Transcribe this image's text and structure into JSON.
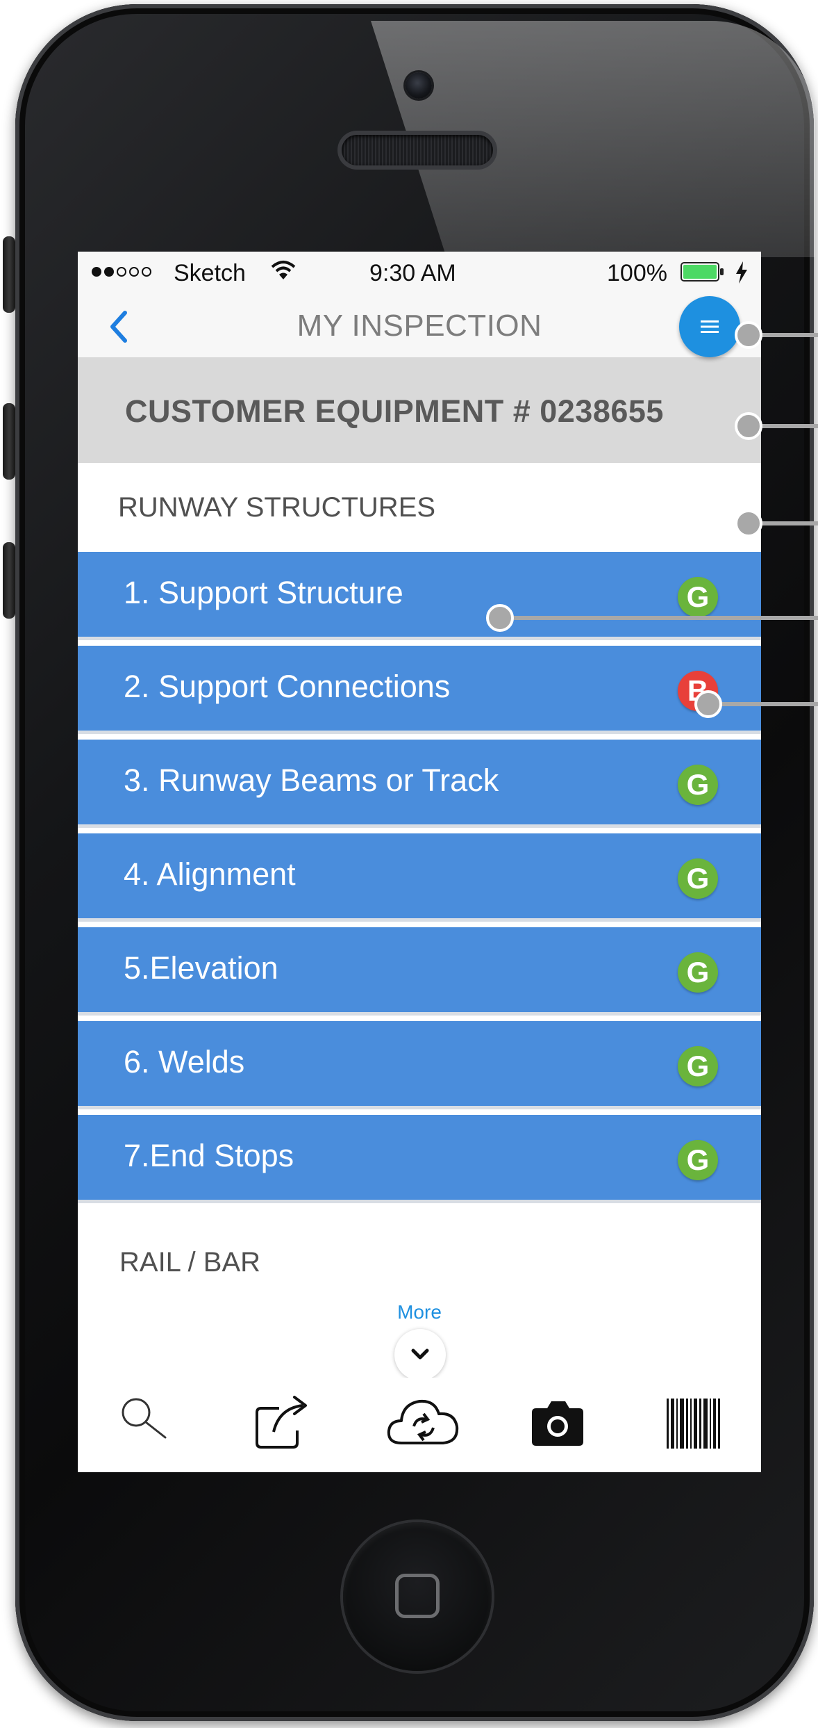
{
  "status_bar": {
    "carrier": "Sketch",
    "time": "9:30 AM",
    "battery": "100%"
  },
  "nav": {
    "title": "MY INSPECTION",
    "back_icon": "chevron-left-icon",
    "menu_icon": "hamburger-menu-icon"
  },
  "equipment": {
    "title": "CUSTOMER EQUIPMENT # 0238655"
  },
  "sections": [
    {
      "title": "RUNWAY STRUCTURES",
      "items": [
        {
          "label": "1. Support Structure",
          "status": "G"
        },
        {
          "label": "2. Support Connections",
          "status": "B"
        },
        {
          "label": "3. Runway Beams or Track",
          "status": "G"
        },
        {
          "label": "4. Alignment",
          "status": "G"
        },
        {
          "label": "5.Elevation",
          "status": "G"
        },
        {
          "label": "6. Welds",
          "status": "G"
        },
        {
          "label": "7.End Stops",
          "status": "G"
        }
      ]
    },
    {
      "title": "RAIL / BAR",
      "items": []
    }
  ],
  "more": {
    "label": "More",
    "icon": "chevron-down-icon"
  },
  "toolbar": {
    "icons": [
      "search-icon",
      "share-icon",
      "cloud-sync-icon",
      "camera-icon",
      "barcode-icon"
    ]
  },
  "colors": {
    "row_blue": "#4a8ddc",
    "accent": "#1e90e0",
    "status_good": "#6ab43c",
    "status_bad": "#e8403a",
    "callout_gray": "#a8a8a8"
  }
}
